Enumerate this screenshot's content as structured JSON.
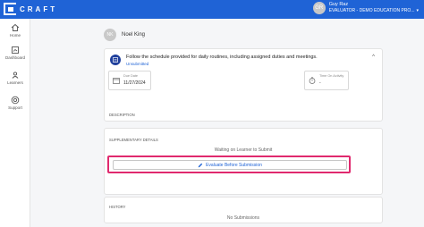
{
  "header": {
    "logo_text": "CRAFT",
    "user_initials": "GR",
    "user_name": "Guy Raz",
    "user_role": "EVALUATOR - DEMO EDUCATION PRO..."
  },
  "sidebar": {
    "items": [
      {
        "label": "Home",
        "icon": "home-icon"
      },
      {
        "label": "Dashboard",
        "icon": "dashboard-icon"
      },
      {
        "label": "Learners",
        "icon": "learners-icon"
      },
      {
        "label": "Support",
        "icon": "support-icon"
      }
    ]
  },
  "learner": {
    "initials": "NK",
    "name": "Noel King"
  },
  "task": {
    "title": "Follow the schedule provided for daily routines, including assigned duties and meetings.",
    "status": "Unsubmitted",
    "due_date_label": "Due Date",
    "due_date_value": "11/27/2024",
    "time_on_activity_label": "Time On Activity",
    "time_on_activity_value": "-",
    "description_label": "DESCRIPTION"
  },
  "supplementary": {
    "label": "SUPPLEMENTARY DETAILS",
    "waiting_text": "Waiting on Learner to Submit",
    "evaluate_button": "Evaluate Before Submission",
    "highlight_color": "#e0296e"
  },
  "history": {
    "label": "HISTORY",
    "empty_text": "No Submissions"
  },
  "colors": {
    "brand": "#1f63d6",
    "task_icon": "#1f3f9c"
  }
}
